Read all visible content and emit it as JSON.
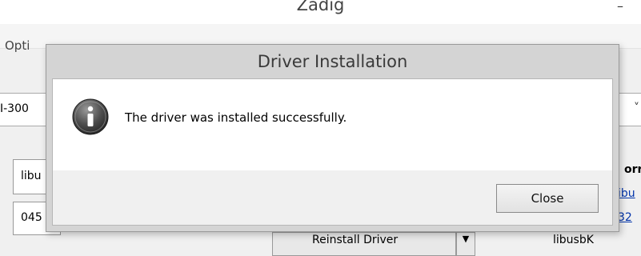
{
  "background_window": {
    "title": "Zadig",
    "minimize_glyph": "–",
    "menu_options_label": "Opti",
    "device_combo_text": "I-300",
    "combo_arrow_glyph": "˅",
    "field1_text": "libu",
    "field2_text": "045",
    "reinstall_label": "Reinstall Driver",
    "reinstall_arrow_glyph": "▼",
    "driver_target": "libusbK",
    "info_header": "orr",
    "info_link1": "ibu",
    "info_link2": "32"
  },
  "dialog": {
    "title": "Driver Installation",
    "icon": "info-icon",
    "message": "The driver was installed successfully.",
    "close_label": "Close"
  }
}
